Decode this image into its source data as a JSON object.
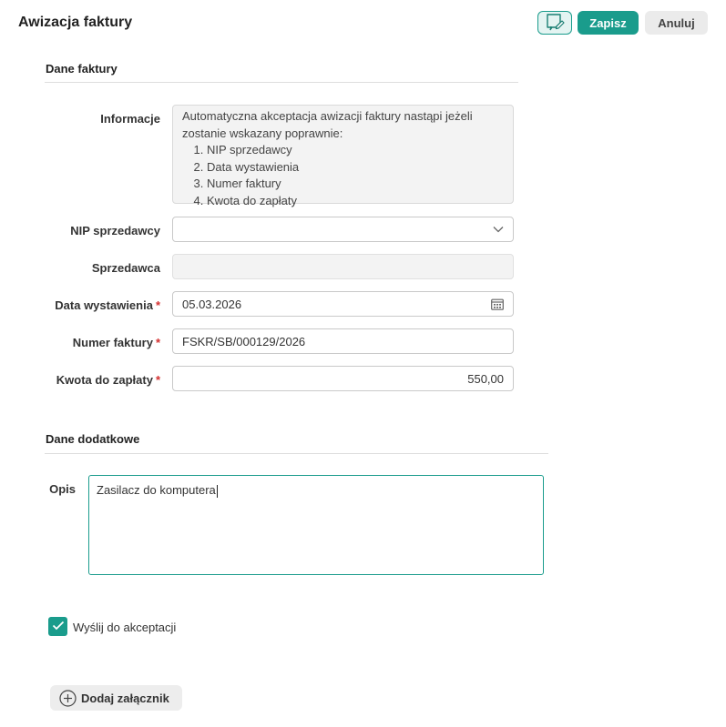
{
  "header": {
    "title": "Awizacja faktury",
    "save_label": "Zapisz",
    "cancel_label": "Anuluj"
  },
  "sections": {
    "invoice_data": "Dane faktury",
    "additional_data": "Dane dodatkowe"
  },
  "info": {
    "label": "Informacje",
    "text": "Automatyczna akceptacja awizacji faktury nastąpi jeżeli zostanie wskazany poprawnie:",
    "items": [
      "NIP sprzedawcy",
      "Data wystawienia",
      "Numer faktury",
      "Kwota do zapłaty"
    ]
  },
  "fields": {
    "nip": {
      "label": "NIP sprzedawcy",
      "value": ""
    },
    "seller": {
      "label": "Sprzedawca",
      "value": ""
    },
    "issue_date": {
      "label": "Data wystawienia",
      "value": "05.03.2026",
      "required_mark": "*"
    },
    "invoice_number": {
      "label": "Numer faktury",
      "value": "FSKR/SB/000129/2026",
      "required_mark": "*"
    },
    "amount": {
      "label": "Kwota do zapłaty",
      "value": "550,00",
      "required_mark": "*"
    }
  },
  "description": {
    "label": "Opis",
    "value": "Zasilacz do komputera"
  },
  "send_for_approval": {
    "label": "Wyślij do akceptacji",
    "checked": true
  },
  "attachment": {
    "label": "Dodaj załącznik"
  },
  "colors": {
    "accent": "#1a9c8c",
    "required": "#d32f2f"
  },
  "icons": {
    "edit": "note-edit-icon",
    "dropdown": "chevron-down-icon",
    "calendar": "calendar-icon",
    "check": "checkmark-icon",
    "add": "plus-circle-icon"
  }
}
